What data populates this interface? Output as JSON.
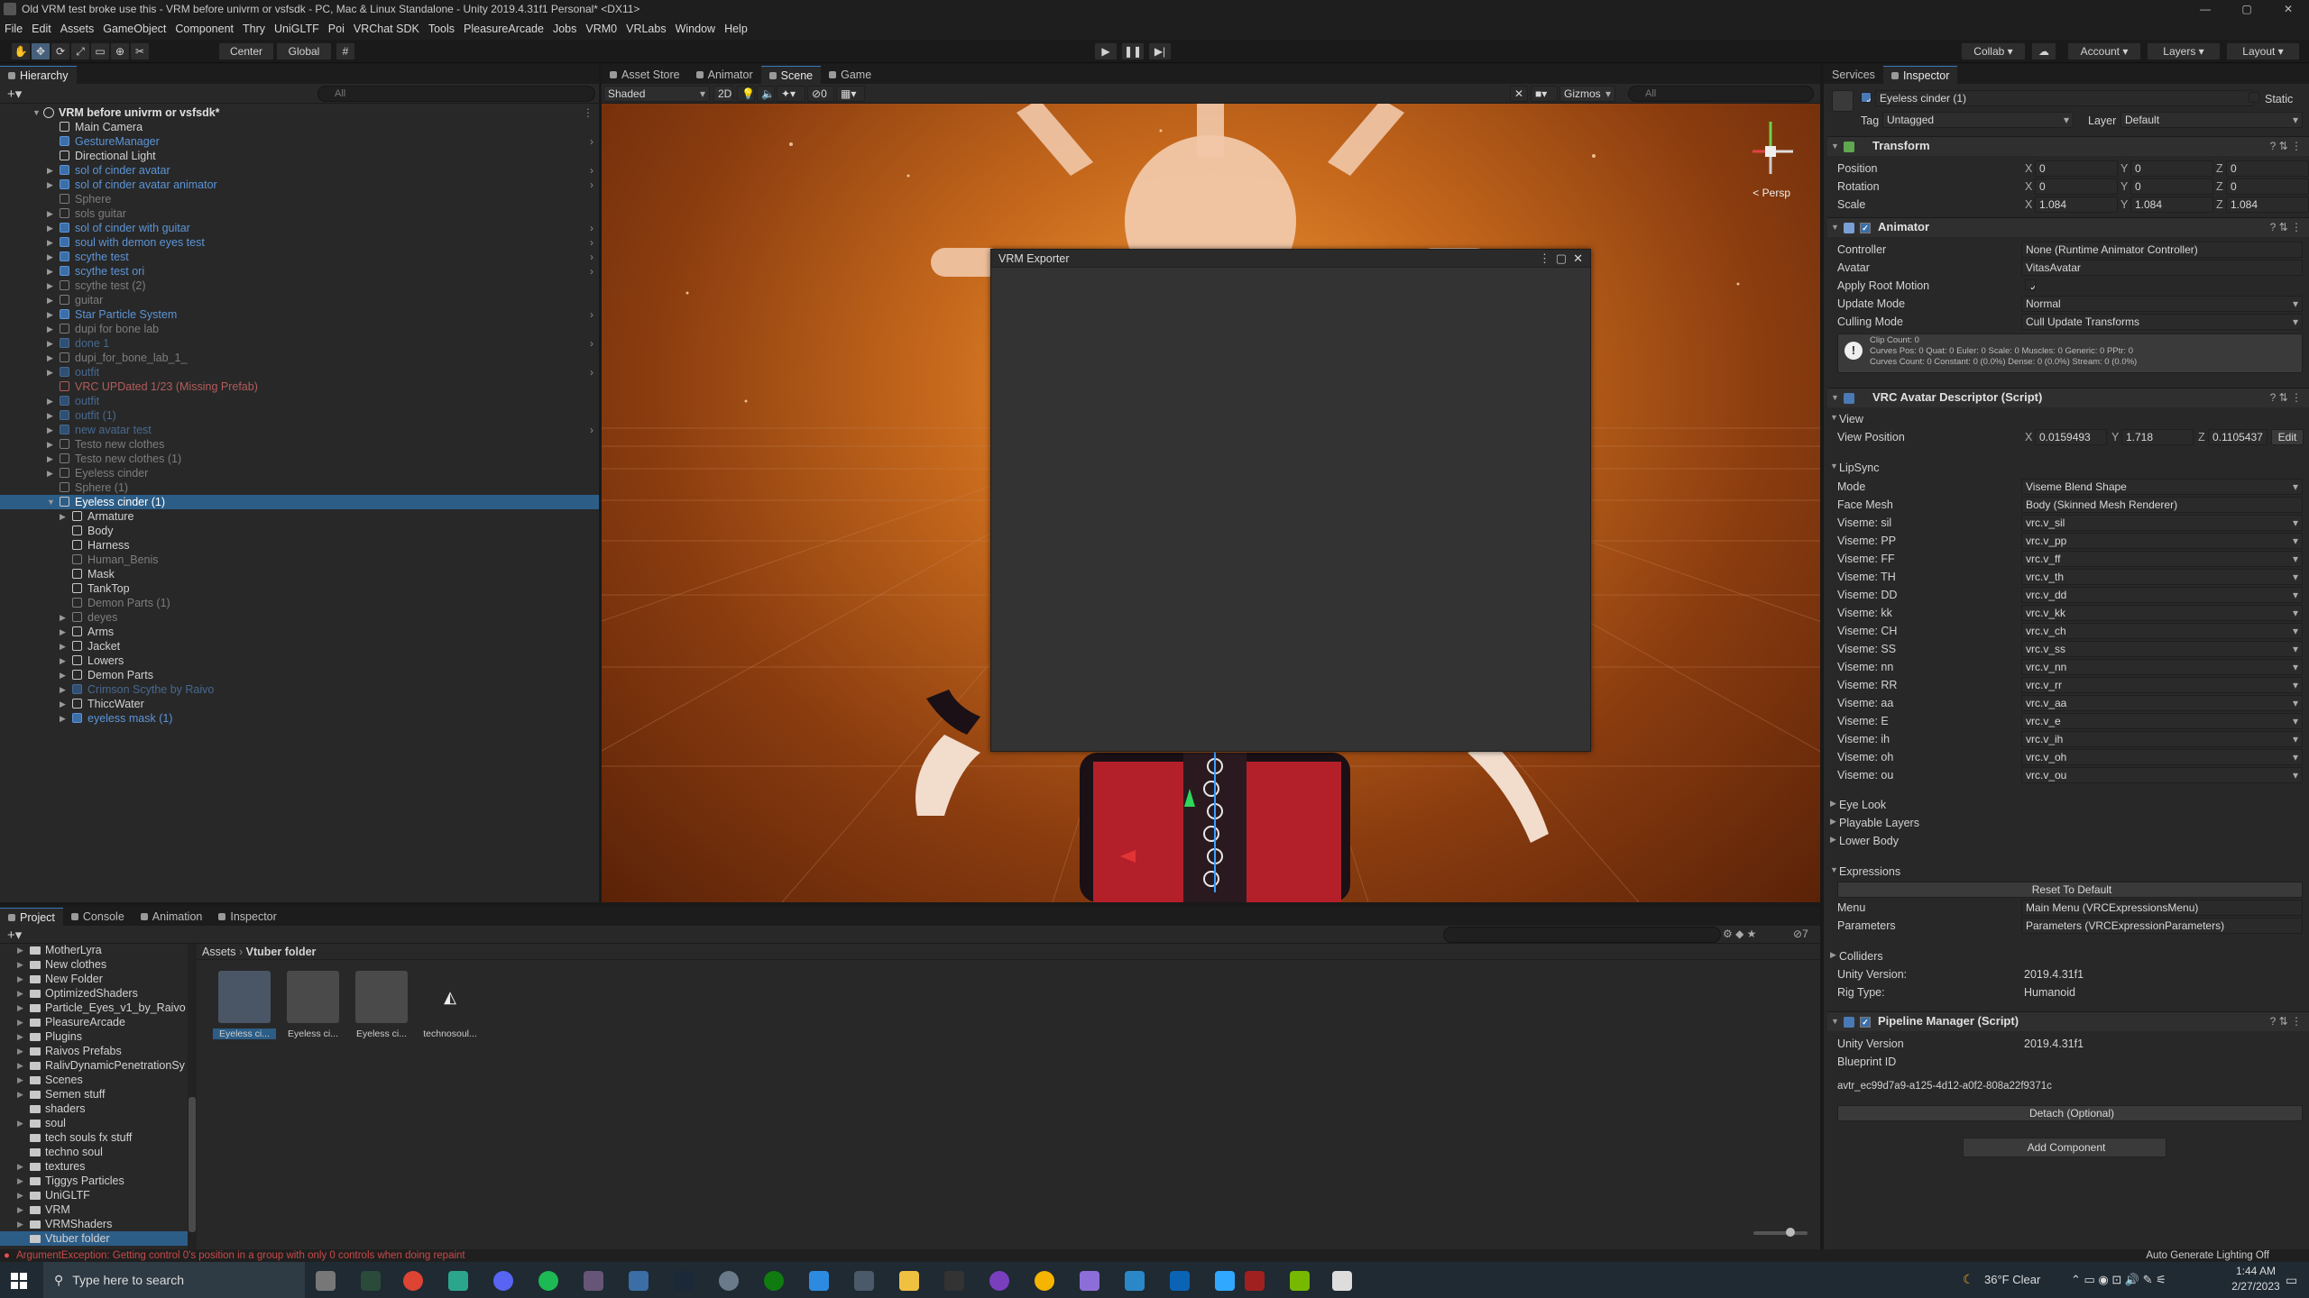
{
  "window": {
    "title": "Old VRM test broke use this - VRM before univrm or vsfsdk - PC, Mac & Linux Standalone - Unity 2019.4.31f1 Personal* <DX11>"
  },
  "menu": [
    "File",
    "Edit",
    "Assets",
    "GameObject",
    "Component",
    "Thry",
    "UniGLTF",
    "Poi",
    "VRChat SDK",
    "Tools",
    "PleasureArcade",
    "Jobs",
    "VRM0",
    "VRLabs",
    "Window",
    "Help"
  ],
  "toolbar": {
    "center": "Center",
    "global": "Global",
    "collab": "Collab",
    "account": "Account",
    "layers": "Layers",
    "layout": "Layout"
  },
  "hierarchy": {
    "tab": "Hierarchy",
    "search": "All",
    "scene": "VRM before univrm or vsfsdk*",
    "items": [
      {
        "label": "Main Camera",
        "style": "",
        "indent": 0,
        "expand": false,
        "chev": false
      },
      {
        "label": "GestureManager",
        "style": "prefab",
        "indent": 0,
        "expand": false,
        "chev": true
      },
      {
        "label": "Directional Light",
        "style": "",
        "indent": 0,
        "expand": false,
        "chev": false
      },
      {
        "label": "sol of cinder avatar",
        "style": "prefab",
        "indent": 0,
        "expand": true,
        "chev": true
      },
      {
        "label": "sol of cinder avatar animator",
        "style": "prefab",
        "indent": 0,
        "expand": true,
        "chev": true
      },
      {
        "label": "Sphere",
        "style": "dim",
        "indent": 0,
        "expand": false,
        "chev": false
      },
      {
        "label": "sols guitar",
        "style": "dim",
        "indent": 0,
        "expand": true,
        "chev": false
      },
      {
        "label": "sol of cinder with guitar",
        "style": "prefab",
        "indent": 0,
        "expand": true,
        "chev": true
      },
      {
        "label": "soul with demon eyes test",
        "style": "prefab",
        "indent": 0,
        "expand": true,
        "chev": true
      },
      {
        "label": "scythe test",
        "style": "prefab",
        "indent": 0,
        "expand": true,
        "chev": true
      },
      {
        "label": "scythe test ori",
        "style": "prefab",
        "indent": 0,
        "expand": true,
        "chev": true
      },
      {
        "label": "scythe test (2)",
        "style": "dim",
        "indent": 0,
        "expand": true,
        "chev": false
      },
      {
        "label": "guitar",
        "style": "dim",
        "indent": 0,
        "expand": true,
        "chev": false
      },
      {
        "label": "Star Particle System",
        "style": "prefab",
        "indent": 0,
        "expand": true,
        "chev": true
      },
      {
        "label": "dupi for bone lab",
        "style": "dim",
        "indent": 0,
        "expand": true,
        "chev": false
      },
      {
        "label": "done 1",
        "style": "dimprefab",
        "indent": 0,
        "expand": true,
        "chev": true
      },
      {
        "label": "dupi_for_bone_lab_1_",
        "style": "dim",
        "indent": 0,
        "expand": true,
        "chev": false
      },
      {
        "label": "outfit",
        "style": "dimprefab",
        "indent": 0,
        "expand": true,
        "chev": true
      },
      {
        "label": "VRC UPDated 1/23 (Missing Prefab)",
        "style": "missing",
        "indent": 0,
        "expand": false,
        "chev": false
      },
      {
        "label": "outfit",
        "style": "dimprefab",
        "indent": 0,
        "expand": true,
        "chev": false
      },
      {
        "label": "outfit (1)",
        "style": "dimprefab",
        "indent": 0,
        "expand": true,
        "chev": false
      },
      {
        "label": "new avatar test",
        "style": "dimprefab",
        "indent": 0,
        "expand": true,
        "chev": true
      },
      {
        "label": "Testo new clothes",
        "style": "dim",
        "indent": 0,
        "expand": true,
        "chev": false
      },
      {
        "label": "Testo new clothes (1)",
        "style": "dim",
        "indent": 0,
        "expand": true,
        "chev": false
      },
      {
        "label": "Eyeless cinder",
        "style": "dim",
        "indent": 0,
        "expand": true,
        "chev": false
      },
      {
        "label": "Sphere (1)",
        "style": "dim",
        "indent": 0,
        "expand": false,
        "chev": false
      },
      {
        "label": "Eyeless cinder (1)",
        "style": "sel",
        "indent": 0,
        "expand": true,
        "chev": false
      },
      {
        "label": "Armature",
        "style": "",
        "indent": 1,
        "expand": true,
        "chev": false
      },
      {
        "label": "Body",
        "style": "",
        "indent": 1,
        "expand": false,
        "chev": false
      },
      {
        "label": "Harness",
        "style": "",
        "indent": 1,
        "expand": false,
        "chev": false
      },
      {
        "label": "Human_Benis",
        "style": "dim",
        "indent": 1,
        "expand": false,
        "chev": false
      },
      {
        "label": "Mask",
        "style": "",
        "indent": 1,
        "expand": false,
        "chev": false
      },
      {
        "label": "TankTop",
        "style": "",
        "indent": 1,
        "expand": false,
        "chev": false
      },
      {
        "label": "Demon Parts (1)",
        "style": "dim",
        "indent": 1,
        "expand": false,
        "chev": false
      },
      {
        "label": "deyes",
        "style": "dim",
        "indent": 1,
        "expand": true,
        "chev": false
      },
      {
        "label": "Arms",
        "style": "",
        "indent": 1,
        "expand": true,
        "chev": false
      },
      {
        "label": "Jacket",
        "style": "",
        "indent": 1,
        "expand": true,
        "chev": false
      },
      {
        "label": "Lowers",
        "style": "",
        "indent": 1,
        "expand": true,
        "chev": false
      },
      {
        "label": "Demon Parts",
        "style": "",
        "indent": 1,
        "expand": true,
        "chev": false
      },
      {
        "label": "Crimson Scythe by Raivo",
        "style": "dimprefab",
        "indent": 1,
        "expand": true,
        "chev": false
      },
      {
        "label": "ThiccWater",
        "style": "",
        "indent": 1,
        "expand": true,
        "chev": false
      },
      {
        "label": "eyeless mask (1)",
        "style": "prefab",
        "indent": 1,
        "expand": true,
        "chev": false
      }
    ]
  },
  "scene": {
    "tabs": [
      "Asset Store",
      "Animator",
      "Scene",
      "Game"
    ],
    "shading": "Shaded",
    "mode2d": "2D",
    "gizmos": "Gizmos",
    "search": "All",
    "persp": "< Persp",
    "fx_count": "0"
  },
  "vrm_exporter": {
    "title": "VRM Exporter"
  },
  "inspector": {
    "tabs": [
      "Services",
      "Inspector"
    ],
    "object_name": "Eyeless cinder (1)",
    "static_label": "Static",
    "tag_label": "Tag",
    "tag": "Untagged",
    "layer_label": "Layer",
    "layer": "Default",
    "transform": {
      "title": "Transform",
      "rows": [
        {
          "label": "Position",
          "x": "0",
          "y": "0",
          "z": "0"
        },
        {
          "label": "Rotation",
          "x": "0",
          "y": "0",
          "z": "0"
        },
        {
          "label": "Scale",
          "x": "1.084",
          "y": "1.084",
          "z": "1.084"
        }
      ]
    },
    "animator": {
      "title": "Animator",
      "controller_label": "Controller",
      "controller": "None (Runtime Animator Controller)",
      "avatar_label": "Avatar",
      "avatar": "VitasAvatar",
      "root_motion_label": "Apply Root Motion",
      "update_label": "Update Mode",
      "update": "Normal",
      "culling_label": "Culling Mode",
      "culling": "Cull Update Transforms",
      "info1": "Clip Count: 0",
      "info2": "Curves Pos: 0 Quat: 0 Euler: 0 Scale: 0 Muscles: 0 Generic: 0 PPtr: 0",
      "info3": "Curves Count: 0 Constant: 0 (0.0%) Dense: 0 (0.0%) Stream: 0 (0.0%)"
    },
    "descriptor": {
      "title": "VRC Avatar Descriptor (Script)",
      "view": "View",
      "view_pos_label": "View Position",
      "vx": "0.0159493",
      "vy": "1.718",
      "vz": "0.1105437",
      "edit": "Edit",
      "lipsync": "LipSync",
      "mode_label": "Mode",
      "mode": "Viseme Blend Shape",
      "face_label": "Face Mesh",
      "face": "Body (Skinned Mesh Renderer)",
      "visemes": [
        {
          "label": "Viseme: sil",
          "value": "vrc.v_sil"
        },
        {
          "label": "Viseme: PP",
          "value": "vrc.v_pp"
        },
        {
          "label": "Viseme: FF",
          "value": "vrc.v_ff"
        },
        {
          "label": "Viseme: TH",
          "value": "vrc.v_th"
        },
        {
          "label": "Viseme: DD",
          "value": "vrc.v_dd"
        },
        {
          "label": "Viseme: kk",
          "value": "vrc.v_kk"
        },
        {
          "label": "Viseme: CH",
          "value": "vrc.v_ch"
        },
        {
          "label": "Viseme: SS",
          "value": "vrc.v_ss"
        },
        {
          "label": "Viseme: nn",
          "value": "vrc.v_nn"
        },
        {
          "label": "Viseme: RR",
          "value": "vrc.v_rr"
        },
        {
          "label": "Viseme: aa",
          "value": "vrc.v_aa"
        },
        {
          "label": "Viseme: E",
          "value": "vrc.v_e"
        },
        {
          "label": "Viseme: ih",
          "value": "vrc.v_ih"
        },
        {
          "label": "Viseme: oh",
          "value": "vrc.v_oh"
        },
        {
          "label": "Viseme: ou",
          "value": "vrc.v_ou"
        }
      ],
      "eye_look": "Eye Look",
      "playable": "Playable Layers",
      "lower_body": "Lower Body",
      "expressions": "Expressions",
      "reset": "Reset To Default",
      "menu_label": "Menu",
      "menu": "Main Menu (VRCExpressionsMenu)",
      "params_label": "Parameters",
      "params": "Parameters (VRCExpressionParameters)",
      "colliders": "Colliders",
      "unity_version_label": "Unity Version:",
      "unity_version": "2019.4.31f1",
      "rig_label": "Rig Type:",
      "rig": "Humanoid"
    },
    "pipeline": {
      "title": "Pipeline Manager (Script)",
      "unity_label": "Unity Version",
      "unity": "2019.4.31f1",
      "blueprint_label": "Blueprint ID",
      "blueprint": "avtr_ec99d7a9-a125-4d12-a0f2-808a22f9371c",
      "detach": "Detach (Optional)"
    },
    "add_component": "Add Component"
  },
  "project": {
    "tabs": [
      "Project",
      "Console",
      "Animation",
      "Inspector"
    ],
    "badge": "7",
    "folders": [
      {
        "label": "MotherLyra",
        "expand": true
      },
      {
        "label": "New clothes",
        "expand": true
      },
      {
        "label": "New Folder",
        "expand": true
      },
      {
        "label": "OptimizedShaders",
        "expand": true
      },
      {
        "label": "Particle_Eyes_v1_by_Raivo",
        "expand": true
      },
      {
        "label": "PleasureArcade",
        "expand": true
      },
      {
        "label": "Plugins",
        "expand": true
      },
      {
        "label": "Raivos Prefabs",
        "expand": true
      },
      {
        "label": "RalivDynamicPenetrationSy",
        "expand": true
      },
      {
        "label": "Scenes",
        "expand": true
      },
      {
        "label": "Semen stuff",
        "expand": true
      },
      {
        "label": "shaders",
        "expand": false
      },
      {
        "label": "soul",
        "expand": true
      },
      {
        "label": "tech souls fx stuff",
        "expand": false
      },
      {
        "label": "techno soul",
        "expand": false
      },
      {
        "label": "textures",
        "expand": true
      },
      {
        "label": "Tiggys Particles",
        "expand": true
      },
      {
        "label": "UniGLTF",
        "expand": true
      },
      {
        "label": "VRM",
        "expand": true
      },
      {
        "label": "VRMShaders",
        "expand": true
      },
      {
        "label": "Vtuber folder",
        "expand": false
      }
    ],
    "breadcrumb_root": "Assets",
    "breadcrumb_leaf": "Vtuber folder",
    "assets": [
      "Eyeless ci...",
      "Eyeless ci...",
      "Eyeless ci...",
      "technosoul..."
    ]
  },
  "status": {
    "error": "ArgumentException: Getting control 0's position in a group with only 0 controls when doing repaint",
    "right": "Auto Generate Lighting Off"
  },
  "taskbar": {
    "search": "Type here to search",
    "weather": "36°F  Clear",
    "time": "1:44 AM",
    "date": "2/27/2023"
  },
  "colors": {
    "accent": "#2c5d87",
    "prefab": "#5c94d6",
    "error": "#e05050"
  }
}
